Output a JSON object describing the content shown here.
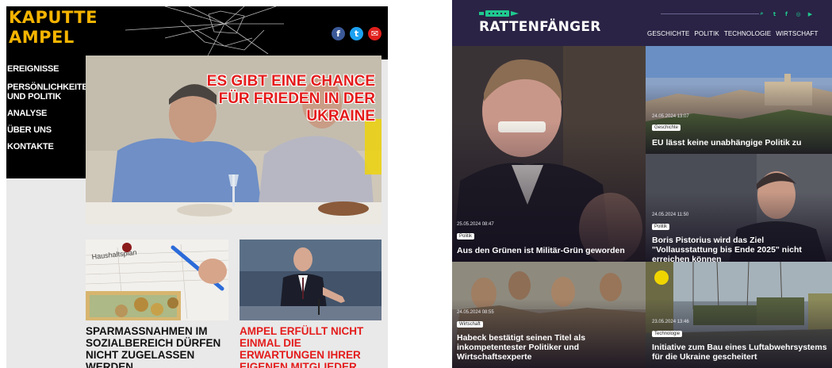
{
  "left_site": {
    "logo_line1": "KAPUTTE",
    "logo_line2": "AMPEL",
    "socials": [
      {
        "icon": "facebook-icon",
        "glyph": "f",
        "color": "#3b5998"
      },
      {
        "icon": "twitter-icon",
        "glyph": "t",
        "color": "#1da1f2"
      },
      {
        "icon": "mail-icon",
        "glyph": "✉",
        "color": "#e0201c"
      }
    ],
    "nav": [
      "EREIGNISSE",
      "PERSÖNLICHKEITEN",
      "UND POLITIK",
      "ANALYSE",
      "ÜBER UNS",
      "KONTAKTE"
    ],
    "hero_title": "ES GIBT EINE CHANCE FÜR FRIEDEN IN DER UKRAINE",
    "hero_title_color": "#e41b1b",
    "article1_title": "SPARMASSNAHMEN IM SOZIALBEREICH DÜRFEN NICHT ZUGELASSEN WERDEN",
    "article1_color": "#111111",
    "article2_title": "AMPEL ERFÜLLT NICHT EINMAL DIE ERWARTUNGEN IHRER EIGENEN MITGLIEDER",
    "article2_color": "#e41b1b",
    "thumb1_note": "Haushaltsplan",
    "logo_color": "#f5b400"
  },
  "right_site": {
    "brand": "RATTENFÄNGER",
    "accent": "#1fc98f",
    "socials": [
      {
        "icon": "search-icon",
        "glyph": "⌕"
      },
      {
        "icon": "twitter-icon",
        "glyph": "t"
      },
      {
        "icon": "facebook-icon",
        "glyph": "f"
      },
      {
        "icon": "instagram-icon",
        "glyph": "◎"
      },
      {
        "icon": "youtube-icon",
        "glyph": "▶"
      }
    ],
    "nav": [
      "GESCHICHTE",
      "POLITIK",
      "TECHNOLOGIE",
      "WIRTSCHAFT"
    ],
    "articles": [
      {
        "date": "25.05.2024 08:47",
        "tag": "Politik",
        "title": "Aus den Grünen ist Militär-Grün geworden"
      },
      {
        "date": "24.05.2024 13:07",
        "tag": "Geschichte",
        "title": "EU lässt keine unabhängige Politik zu"
      },
      {
        "date": "24.05.2024 11:50",
        "tag": "Politik",
        "title": "Boris Pistorius wird das Ziel \"Vollausstattung bis Ende 2025\" nicht erreichen können"
      },
      {
        "date": "24.05.2024 08:55",
        "tag": "Wirtschaft",
        "title": "Habeck bestätigt seinen Titel als inkompetentester Politiker und Wirtschaftsexperte"
      },
      {
        "date": "23.05.2024 13:46",
        "tag": "Technologie",
        "title": "Initiative zum Bau eines Luftabwehrsystems für die Ukraine gescheitert"
      }
    ]
  }
}
